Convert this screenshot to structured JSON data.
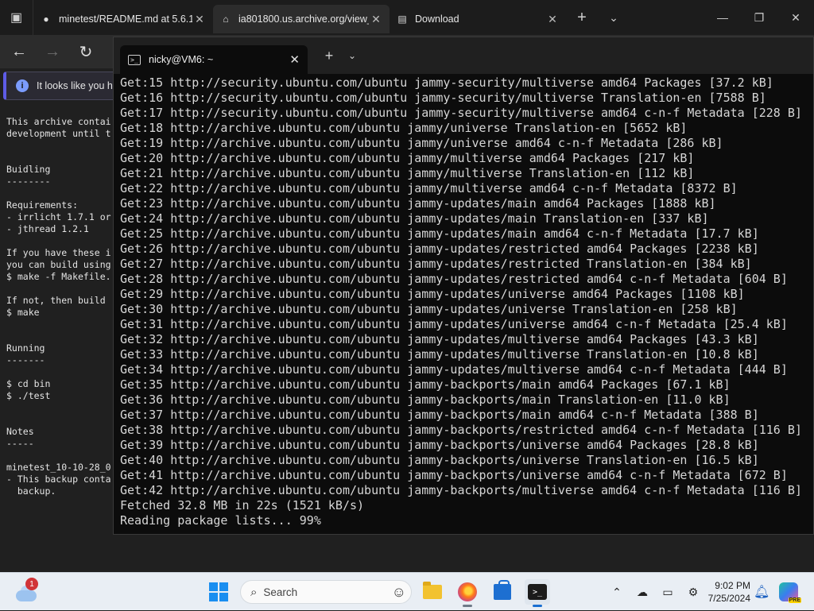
{
  "browser": {
    "tabs": [
      {
        "label": "minetest/README.md at 5.6.1 ·",
        "icon": "github-icon"
      },
      {
        "label": "ia801800.us.archive.org/view_a",
        "icon": "archive-icon"
      },
      {
        "label": "Download",
        "icon": "download-page-icon"
      }
    ],
    "info_bar_text": "It looks like you ha"
  },
  "page": {
    "lines": [
      "This archive contai",
      "development until t",
      "",
      "",
      "Buidling",
      "--------",
      "",
      "Requirements:",
      "- irrlicht 1.7.1 or",
      "- jthread 1.2.1",
      "",
      "If you have these i",
      "you can build using",
      "$ make -f Makefile.",
      "",
      "If not, then build",
      "$ make",
      "",
      "",
      "Running",
      "-------",
      "",
      "$ cd bin",
      "$ ./test",
      "",
      "",
      "Notes",
      "-----",
      "",
      "minetest_10-10-28_0",
      "- This backup conta",
      "  backup."
    ]
  },
  "terminal": {
    "tab_title": "nicky@VM6: ~",
    "lines": [
      "Get:15 http://security.ubuntu.com/ubuntu jammy-security/multiverse amd64 Packages [37.2 kB]",
      "Get:16 http://security.ubuntu.com/ubuntu jammy-security/multiverse Translation-en [7588 B]",
      "Get:17 http://security.ubuntu.com/ubuntu jammy-security/multiverse amd64 c-n-f Metadata [228 B]",
      "Get:18 http://archive.ubuntu.com/ubuntu jammy/universe Translation-en [5652 kB]",
      "Get:19 http://archive.ubuntu.com/ubuntu jammy/universe amd64 c-n-f Metadata [286 kB]",
      "Get:20 http://archive.ubuntu.com/ubuntu jammy/multiverse amd64 Packages [217 kB]",
      "Get:21 http://archive.ubuntu.com/ubuntu jammy/multiverse Translation-en [112 kB]",
      "Get:22 http://archive.ubuntu.com/ubuntu jammy/multiverse amd64 c-n-f Metadata [8372 B]",
      "Get:23 http://archive.ubuntu.com/ubuntu jammy-updates/main amd64 Packages [1888 kB]",
      "Get:24 http://archive.ubuntu.com/ubuntu jammy-updates/main Translation-en [337 kB]",
      "Get:25 http://archive.ubuntu.com/ubuntu jammy-updates/main amd64 c-n-f Metadata [17.7 kB]",
      "Get:26 http://archive.ubuntu.com/ubuntu jammy-updates/restricted amd64 Packages [2238 kB]",
      "Get:27 http://archive.ubuntu.com/ubuntu jammy-updates/restricted Translation-en [384 kB]",
      "Get:28 http://archive.ubuntu.com/ubuntu jammy-updates/restricted amd64 c-n-f Metadata [604 B]",
      "Get:29 http://archive.ubuntu.com/ubuntu jammy-updates/universe amd64 Packages [1108 kB]",
      "Get:30 http://archive.ubuntu.com/ubuntu jammy-updates/universe Translation-en [258 kB]",
      "Get:31 http://archive.ubuntu.com/ubuntu jammy-updates/universe amd64 c-n-f Metadata [25.4 kB]",
      "Get:32 http://archive.ubuntu.com/ubuntu jammy-updates/multiverse amd64 Packages [43.3 kB]",
      "Get:33 http://archive.ubuntu.com/ubuntu jammy-updates/multiverse Translation-en [10.8 kB]",
      "Get:34 http://archive.ubuntu.com/ubuntu jammy-updates/multiverse amd64 c-n-f Metadata [444 B]",
      "Get:35 http://archive.ubuntu.com/ubuntu jammy-backports/main amd64 Packages [67.1 kB]",
      "Get:36 http://archive.ubuntu.com/ubuntu jammy-backports/main Translation-en [11.0 kB]",
      "Get:37 http://archive.ubuntu.com/ubuntu jammy-backports/main amd64 c-n-f Metadata [388 B]",
      "Get:38 http://archive.ubuntu.com/ubuntu jammy-backports/restricted amd64 c-n-f Metadata [116 B]",
      "Get:39 http://archive.ubuntu.com/ubuntu jammy-backports/universe amd64 Packages [28.8 kB]",
      "Get:40 http://archive.ubuntu.com/ubuntu jammy-backports/universe Translation-en [16.5 kB]",
      "Get:41 http://archive.ubuntu.com/ubuntu jammy-backports/universe amd64 c-n-f Metadata [672 B]",
      "Get:42 http://archive.ubuntu.com/ubuntu jammy-backports/multiverse amd64 c-n-f Metadata [116 B]",
      "Fetched 32.8 MB in 22s (1521 kB/s)",
      "Reading package lists... 99%"
    ]
  },
  "taskbar": {
    "weather_badge": "1",
    "search_placeholder": "Search",
    "time": "9:02 PM",
    "date": "7/25/2024",
    "copilot_badge": "PRE"
  },
  "colors": {
    "terminal_bg": "#0c0c0c",
    "terminal_text": "#d6d6d6",
    "taskbar_bg": "#e9eef4",
    "start_blue": "#1a8ef0"
  }
}
